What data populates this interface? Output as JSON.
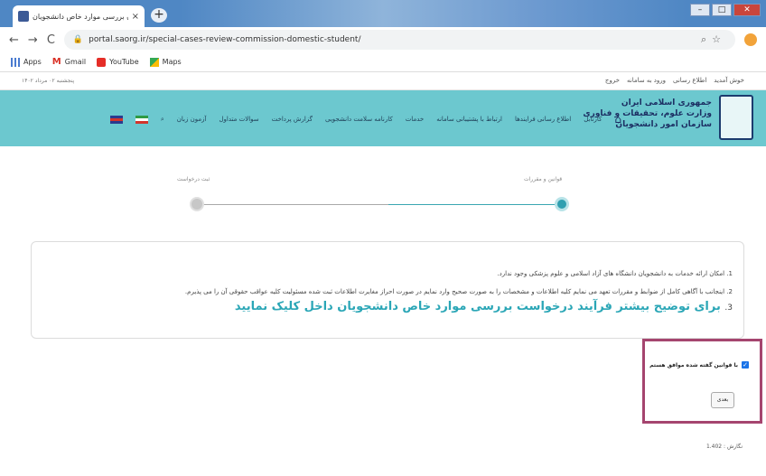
{
  "browser": {
    "tab_title": "کمیسیون بررسی موارد خاص دانشجویان",
    "tab_close": "×",
    "new_tab": "+",
    "url": "portal.saorg.ir/special-cases-review-commission-domestic-student/",
    "bookmarks": [
      "Apps",
      "Gmail",
      "YouTube",
      "Maps"
    ]
  },
  "site": {
    "top_left_text": "پنجشنبه ۰۲ مرداد ۱۴۰۲",
    "top_links": [
      "خوش آمدید",
      "اطلاع رسانی",
      "ورود به سامانه",
      "خروج"
    ],
    "logo_lines": [
      "جمهوری اسلامی ایران",
      "وزارت علوم، تحقیقات و فناوری",
      "سازمان امور دانشجویان"
    ],
    "menu": [
      "کارتابل",
      "اطلاع رسانی فرایندها",
      "ارتباط با پشتیبانی سامانه",
      "خدمات",
      "کارنامه سلامت دانشجویی",
      "گزارش پرداخت",
      "سوالات متداول",
      "آزمون زبان"
    ]
  },
  "stepper": {
    "step1_label": "قوانین و مقررات",
    "step2_label": "ثبت درخواست"
  },
  "info": {
    "line1": "1. امکان ارائه خدمات به دانشجویان دانشگاه های آزاد اسلامی و علوم پزشکی وجود ندارد.",
    "line2": "2. اینجانب با آگاهی کامل از ضوابط و مقررات تعهد می نمایم کلیه اطلاعات و مشخصات را به صورت صحیح وارد نمایم در صورت احراز مغایرت اطلاعات ثبت شده مسئولیت کلیه عواقب حقوقی آن را می پذیرم.",
    "line3_num": "3.",
    "line3_link": "برای توضیح بیشتر فرآیند درخواست بررسی موارد خاص دانشجویان داخل کلیک نمایید"
  },
  "agreement": {
    "checkbox_label": "با قوانین گفته شده موافق هستم",
    "checked": true,
    "next_button": "بعدی"
  },
  "footer": {
    "version": "نگارش : 1.402"
  },
  "colors": {
    "header_teal": "#6cc8cf",
    "active_step": "#2f9fb0",
    "highlight_border": "#a5456f",
    "link_teal": "#2aa6b6"
  }
}
